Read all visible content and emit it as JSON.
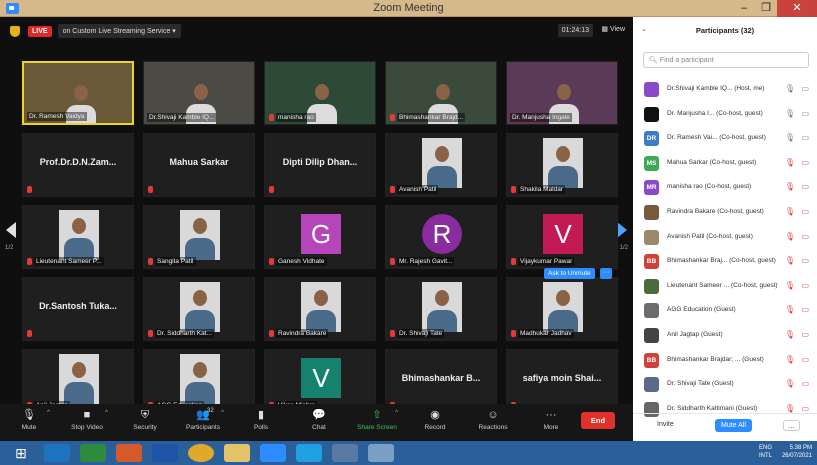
{
  "window": {
    "title": "Zoom Meeting",
    "min": "–",
    "max": "❐",
    "close": "✕"
  },
  "topbar": {
    "live": "LIVE",
    "stream": "on Custom Live Streaming Service ▾",
    "timer": "01:24:13",
    "view": "▦ View"
  },
  "pager": {
    "left": "1/2",
    "right": "1/2"
  },
  "tiles": [
    {
      "name": "Dr. Ramesh Vaidya",
      "kind": "video",
      "bg": "#6b5a3a",
      "active": true
    },
    {
      "name": "Dr.Shivaji Kamble IQ...",
      "kind": "video",
      "bg": "#4b4a44"
    },
    {
      "name": "manisha rao",
      "kind": "video",
      "bg": "#2c4a36",
      "mic": true
    },
    {
      "name": "Bhimashankar Brajd...",
      "kind": "video",
      "bg": "#3c4a3c",
      "mic": true
    },
    {
      "name": "Dr. Manjusha Ingale",
      "kind": "video",
      "bg": "#5a3a57"
    },
    {
      "big": "Prof.Dr.D.N.Zam...",
      "kind": "text",
      "mic": true
    },
    {
      "big": "Mahua Sarkar",
      "kind": "text",
      "mic": true
    },
    {
      "big": "Dipti Dilip Dhan...",
      "kind": "text",
      "mic": true
    },
    {
      "name": "Avanish Patil",
      "kind": "photo",
      "mic": true
    },
    {
      "name": "Shakila Maldar",
      "kind": "photo",
      "mic": true
    },
    {
      "name": "Lieutenant Sameer P...",
      "kind": "photo",
      "mic": true
    },
    {
      "name": "Sangita Patil",
      "kind": "photo",
      "mic": true
    },
    {
      "name": "Ganesh Vidhate",
      "kind": "letter",
      "letter": "G",
      "color": "#b545b8",
      "mic": true
    },
    {
      "name": "Mr. Rajesh Gavit...",
      "kind": "letterround",
      "letter": "R",
      "color": "#8a2c9e",
      "mic": true
    },
    {
      "name": "Vijaykumar Pawar",
      "kind": "letter",
      "letter": "V",
      "color": "#c21a55",
      "mic": true
    },
    {
      "big": "Dr.Santosh Tuka...",
      "kind": "text",
      "mic": true
    },
    {
      "name": "Dr. Siddharth Kat...",
      "kind": "photo",
      "mic": true
    },
    {
      "name": "Ravindra Bakare",
      "kind": "photo",
      "mic": true
    },
    {
      "name": "Dr. Shivaji Tate",
      "kind": "photo",
      "mic": true
    },
    {
      "name": "Madhukar Jadhav",
      "kind": "photo",
      "mic": true
    },
    {
      "name": "Anil Jagtap",
      "kind": "photo",
      "mic": true
    },
    {
      "name": "AGG Education",
      "kind": "photo",
      "mic": true
    },
    {
      "name": "Vikas Mishra",
      "kind": "letter",
      "letter": "V",
      "color": "#16816d",
      "mic": true
    },
    {
      "big": "Bhimashankar B...",
      "kind": "text",
      "mic": true
    },
    {
      "big": "safiya moin Shai...",
      "kind": "text",
      "mic": true
    }
  ],
  "unmute": "Ask to Unmute",
  "unmute_more": "···",
  "toolbar": [
    {
      "label": "Mute",
      "icon": "🎙",
      "caret": true
    },
    {
      "label": "Stop Video",
      "icon": "■",
      "caret": true
    },
    {
      "label": "Security",
      "icon": "⛨"
    },
    {
      "label": "Participants",
      "icon": "👥",
      "count": "32",
      "caret": true
    },
    {
      "label": "Polls",
      "icon": "▮"
    },
    {
      "label": "Chat",
      "icon": "💬"
    },
    {
      "label": "Share Screen",
      "icon": "⇧",
      "green": true,
      "caret": true
    },
    {
      "label": "Record",
      "icon": "◉"
    },
    {
      "label": "Reactions",
      "icon": "☺"
    },
    {
      "label": "More",
      "icon": "···"
    }
  ],
  "end": "End",
  "panel": {
    "title": "Participants (32)",
    "search_placeholder": "Find a participant",
    "participants": [
      {
        "initials": "",
        "color": "#8a49c9",
        "name": "Dr.Shivaji Kamble IQ... (Host, me)",
        "mic_ok": true,
        "cam_ok": true
      },
      {
        "initials": "",
        "color": "#111111",
        "name": "Dr. Manjusha I... (Co-host, guest)",
        "mic_ok": true,
        "cam_ok": true
      },
      {
        "initials": "DR",
        "color": "#3b7dc9",
        "name": "Dr. Ramesh Vai... (Co-host, guest)",
        "mic_ok": true,
        "cam_ok": true
      },
      {
        "initials": "MS",
        "color": "#3caa55",
        "name": "Mahua Sarkar (Co-host, guest)"
      },
      {
        "initials": "MR",
        "color": "#8a49c9",
        "name": "manisha rao (Co-host, guest)"
      },
      {
        "initials": "",
        "color": "#7a5a3c",
        "name": "Ravindra Bakare (Co-host, guest)"
      },
      {
        "initials": "",
        "color": "#9a8a6c",
        "name": "Avanish Patil (Co-host, guest)"
      },
      {
        "initials": "BB",
        "color": "#d0413a",
        "name": "Bhimashankar Braj... (Co-host, guest)"
      },
      {
        "initials": "",
        "color": "#4d6a3a",
        "name": "Lieutenant Sameer ... (Co-host, guest)"
      },
      {
        "initials": "",
        "color": "#6c6c6c",
        "name": "AGG Education (Guest)"
      },
      {
        "initials": "",
        "color": "#444444",
        "name": "Anil Jagtap (Guest)"
      },
      {
        "initials": "BB",
        "color": "#d0413a",
        "name": "Bhimashankar Brajdar; ... (Guest)"
      },
      {
        "initials": "",
        "color": "#5a6a8a",
        "name": "Dr. Shivaji Tate (Guest)"
      },
      {
        "initials": "",
        "color": "#666666",
        "name": "Dr. Siddharth Kattimani (Guest)"
      }
    ],
    "invite": "Invite",
    "mute_all": "Mute All",
    "more": "..."
  },
  "taskbar": {
    "lang": "ENG",
    "region": "INTL",
    "time": "5:38 PM",
    "date": "26/07/2021"
  }
}
